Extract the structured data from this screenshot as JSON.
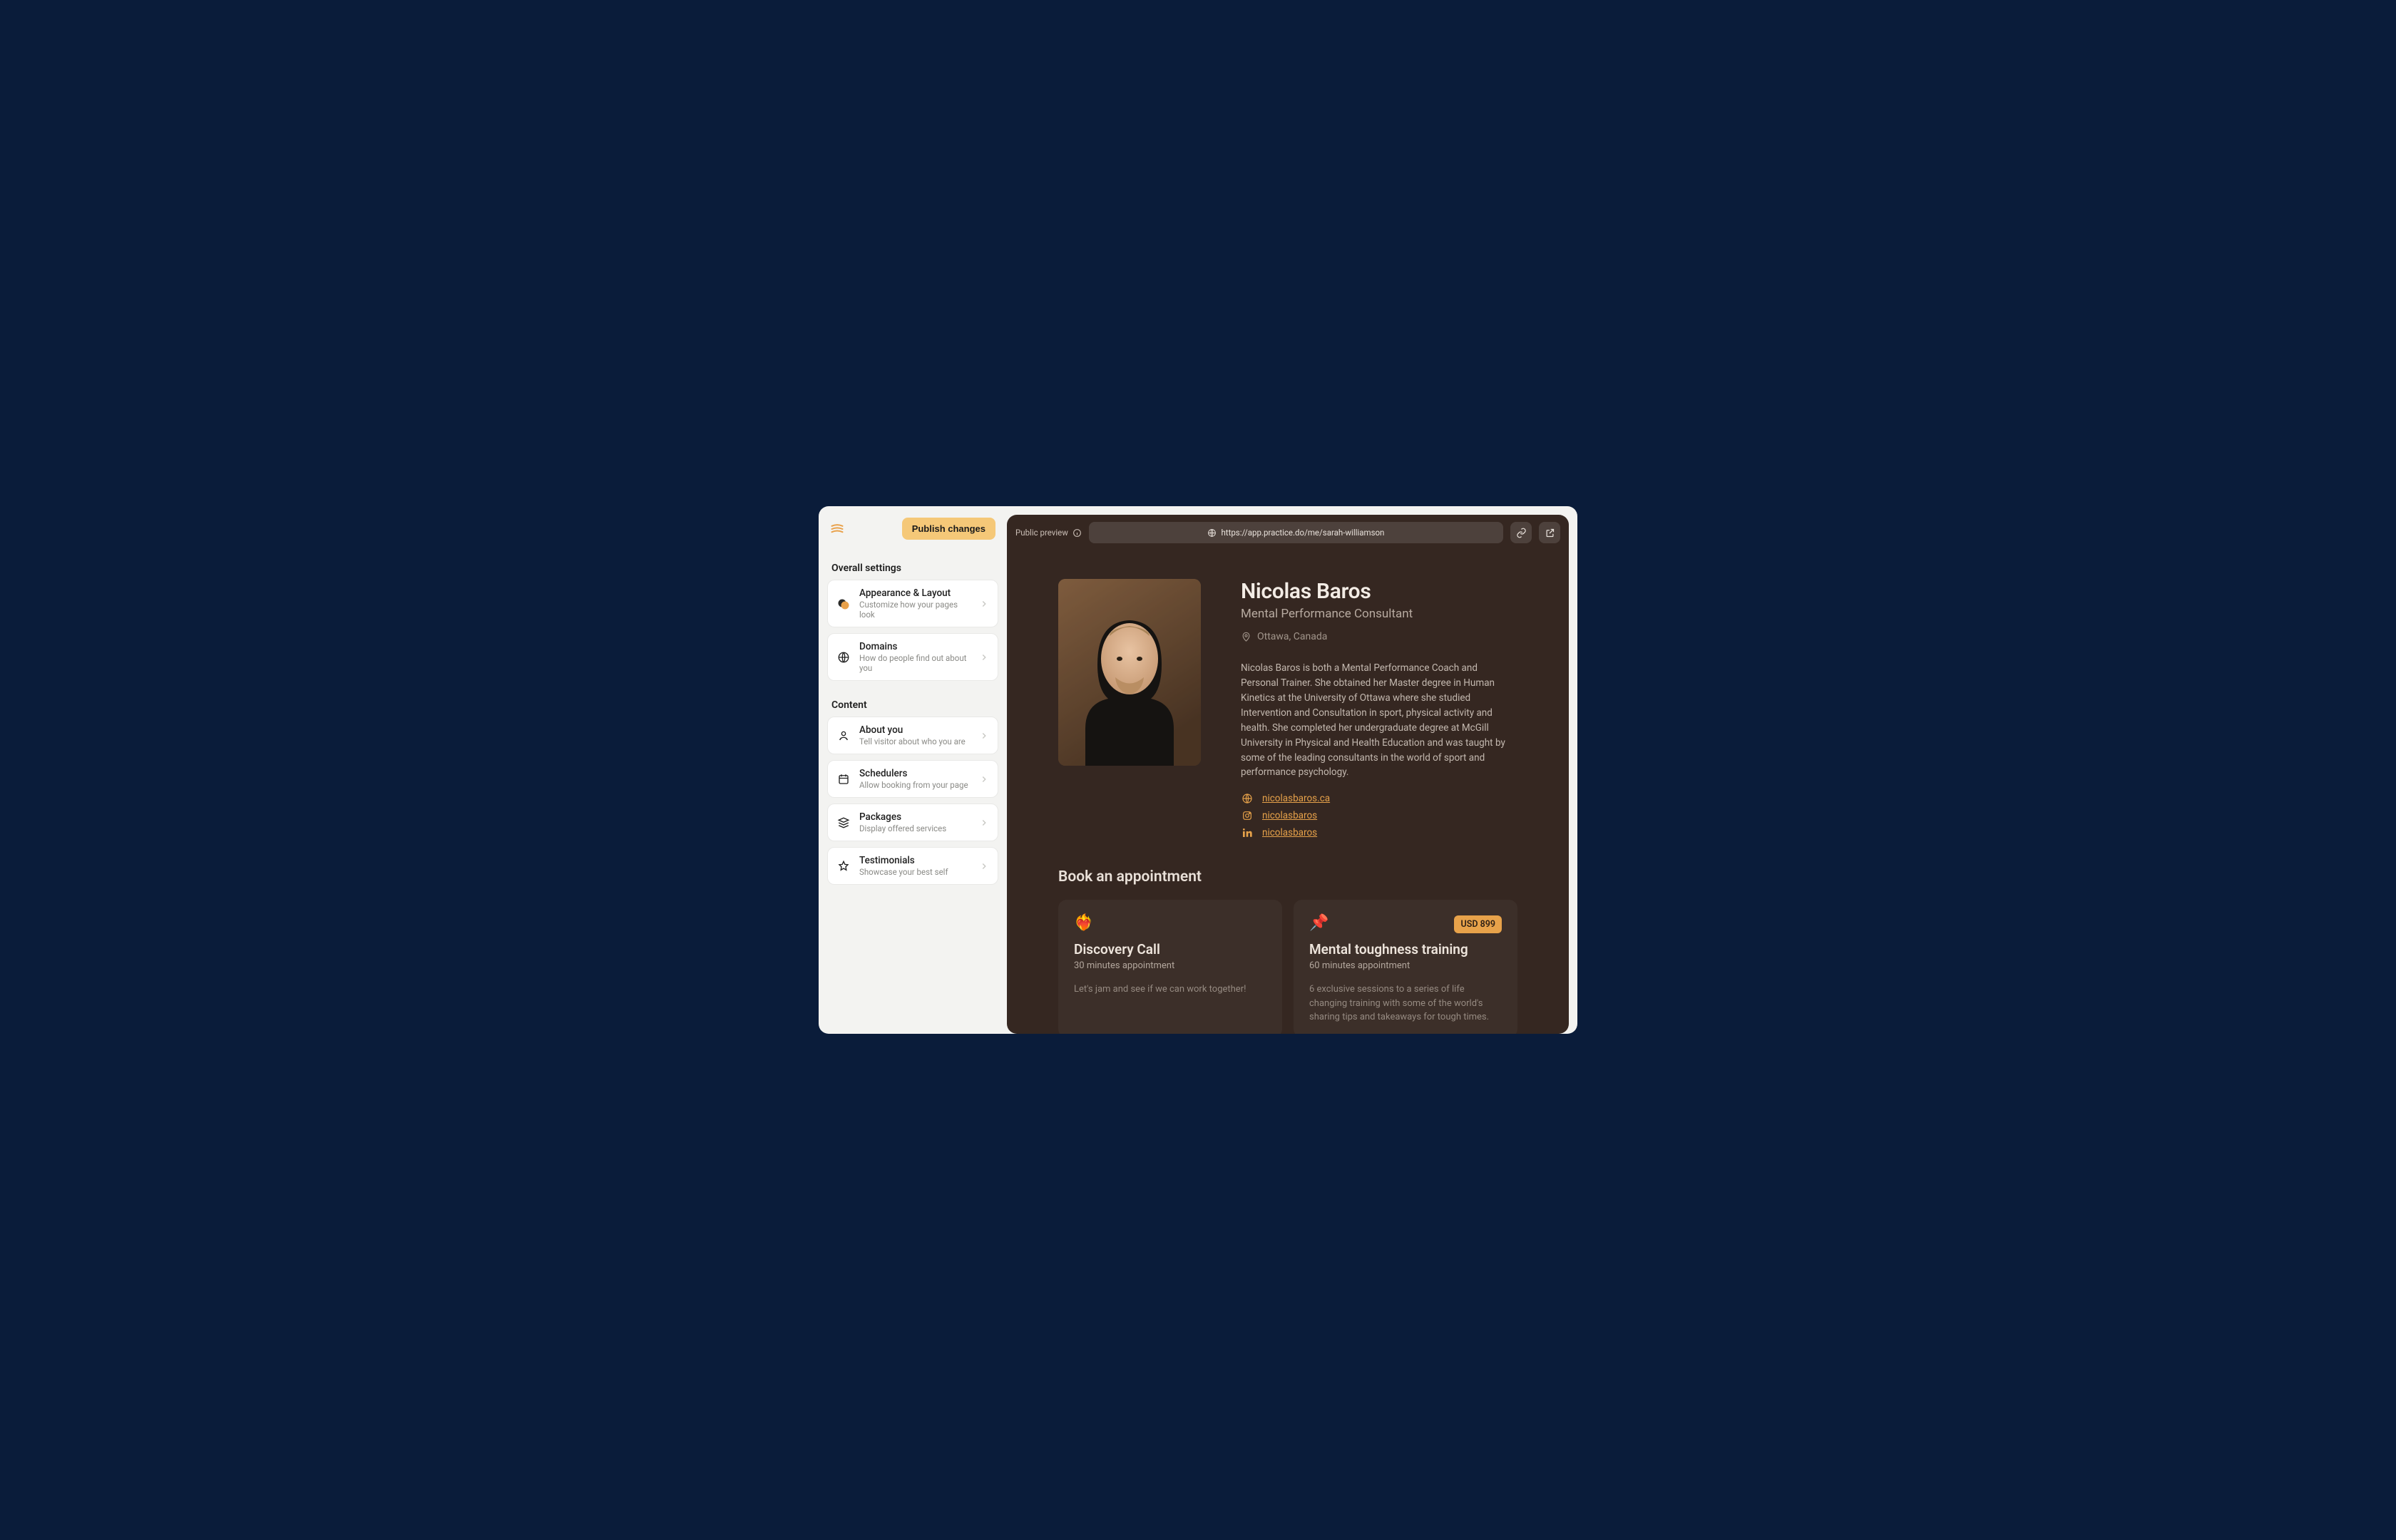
{
  "sidebar": {
    "publish_label": "Publish changes",
    "sections": {
      "overall": {
        "heading": "Overall settings",
        "items": [
          {
            "title": "Appearance & Layout",
            "sub": "Customize how your pages look"
          },
          {
            "title": "Domains",
            "sub": "How do people find out about you"
          }
        ]
      },
      "content": {
        "heading": "Content",
        "items": [
          {
            "title": "About you",
            "sub": "Tell visitor about who you are"
          },
          {
            "title": "Schedulers",
            "sub": "Allow booking from your page"
          },
          {
            "title": "Packages",
            "sub": "Display offered services"
          },
          {
            "title": "Testimonials",
            "sub": "Showcase your best self"
          }
        ]
      }
    }
  },
  "preview": {
    "label": "Public preview",
    "url": "https://app.practice.do/me/sarah-williamson",
    "profile": {
      "name": "Nicolas Baros",
      "role": "Mental Performance Consultant",
      "location": "Ottawa, Canada",
      "bio": "Nicolas Baros is both a Mental Performance Coach and Personal Trainer. She obtained her Master degree in Human Kinetics at the University of Ottawa where she studied Intervention and Consultation in sport, physical activity and health. She completed her undergraduate degree at McGill University in Physical and Health Education and was taught by some of the leading consultants in the world of sport and performance psychology.",
      "links": [
        {
          "kind": "website",
          "label": "nicolasbaros.ca"
        },
        {
          "kind": "instagram",
          "label": "nicolasbaros"
        },
        {
          "kind": "linkedin",
          "label": "nicolasbaros"
        }
      ]
    },
    "book_heading": "Book an appointment",
    "appointments": [
      {
        "emoji": "❤️‍🔥",
        "title": "Discovery Call",
        "duration": "30 minutes appointment",
        "desc": "Let's jam and see if we can work together!",
        "price": null
      },
      {
        "emoji": "📌",
        "title": "Mental toughness training",
        "duration": "60 minutes appointment",
        "desc": "6 exclusive sessions to a series of life changing training with some of the world's sharing tips and takeaways for tough times.",
        "price": "USD 899"
      }
    ]
  }
}
